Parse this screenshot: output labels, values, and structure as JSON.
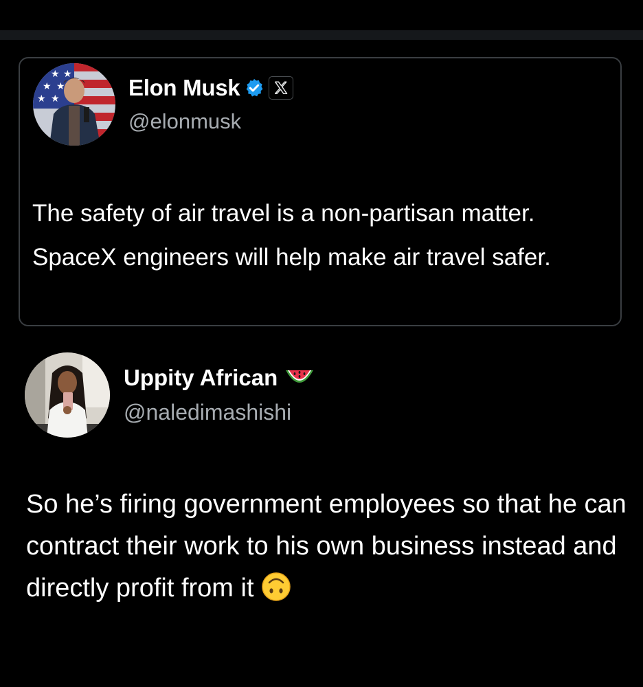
{
  "quoted_tweet": {
    "author_name": "Elon Musk",
    "handle": "@elonmusk",
    "verified_color": "#1d9bf0",
    "badge_icon": "verified-badge-icon",
    "affiliation_icon": "x-logo-icon",
    "body": "The safety of air travel is a non-partisan matter. SpaceX engineers will help make air travel safer."
  },
  "reply_tweet": {
    "author_name": "Uppity African",
    "name_emoji_icon": "watermelon-emoji",
    "handle": "@naledimashishi",
    "body": "So he’s firing government employees so that he can contract their work to his own business instead and directly profit from it",
    "trailing_emoji_icon": "upside-down-face-emoji"
  },
  "colors": {
    "background": "#000000",
    "text_primary": "#ffffff",
    "text_secondary": "#a7acb1",
    "card_border": "#3a3e42"
  }
}
